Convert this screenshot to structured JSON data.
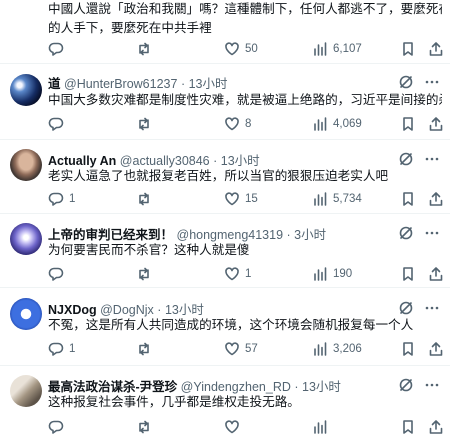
{
  "colors": {
    "text": "#0f1419",
    "secondary": "#536471",
    "divider": "#eff3f4"
  },
  "tweets": [
    {
      "display_name": "",
      "handle": "",
      "time": "",
      "lines": [
        "中國人還說「政治和我關」嗎？這種體制下，任何人都逃不了，要麼死在這樣",
        "的人手下，要麼死在中共手裡"
      ],
      "reply": "",
      "retweet": "",
      "like": "50",
      "views": "6,107"
    },
    {
      "display_name": "道",
      "handle": "@HunterBrow61237",
      "time": "13小时",
      "lines": [
        "中国大多数灾难都是制度性灾难，就是被逼上绝路的，习近平是间接的杀手！"
      ],
      "reply": "",
      "retweet": "",
      "like": "8",
      "views": "4,069"
    },
    {
      "display_name": "Actually An",
      "handle": "@actually30846",
      "time": "13小时",
      "lines": [
        "老实人逼急了也就报复老百姓，所以当官的狠狠压迫老实人吧"
      ],
      "reply": "1",
      "retweet": "",
      "like": "15",
      "views": "5,734"
    },
    {
      "display_name": "上帝的审判已经来到！",
      "handle": "@hongmeng41319",
      "time": "3小时",
      "lines": [
        "为何要害民而不杀官？这种人就是傻"
      ],
      "reply": "",
      "retweet": "",
      "like": "1",
      "views": "190"
    },
    {
      "display_name": "NJXDog",
      "handle": "@DogNjx",
      "time": "13小时",
      "lines": [
        "不冤，这是所有人共同造成的环境，这个环境会随机报复每一个人"
      ],
      "reply": "1",
      "retweet": "",
      "like": "57",
      "views": "3,206"
    },
    {
      "display_name": "最高法政治谋杀-尹登珍",
      "handle": "@Yindengzhen_RD",
      "time": "13小时",
      "lines": [
        "这种报复社会事件，几乎都是维权走投无路。"
      ],
      "reply": "",
      "retweet": "",
      "like": "",
      "views": ""
    }
  ]
}
